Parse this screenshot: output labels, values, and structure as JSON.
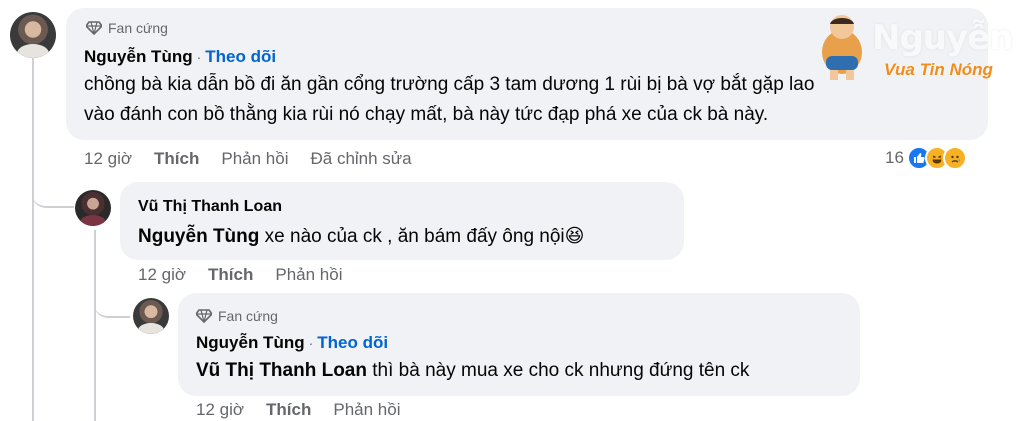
{
  "comment1": {
    "badge": "Fan cứng",
    "author": "Nguyễn Tùng",
    "follow": "Theo dõi",
    "line1": "chồng bà kia dẫn bồ đi ăn gần cổng trường cấp 3 tam dương 1 rùi bị bà vợ bắt gặp lao",
    "line2": "vào đánh con bồ thằng kia rùi nó chạy mất, bà này tức đạp phá xe của ck bà này.",
    "time": "12 giờ",
    "like": "Thích",
    "reply": "Phản hồi",
    "edited": "Đã chỉnh sửa",
    "reaction_count": "16",
    "reactions": [
      "like-icon",
      "laugh-icon",
      "sad-icon"
    ]
  },
  "comment2": {
    "author": "Vũ Thị Thanh Loan",
    "mention": "Nguyễn Tùng",
    "text": " xe nào của ck , ăn bám đấy ông nội",
    "emoji": "😆",
    "time": "12 giờ",
    "like": "Thích",
    "reply": "Phản hồi"
  },
  "comment3": {
    "badge": "Fan cứng",
    "author": "Nguyễn Tùng",
    "follow": "Theo dõi",
    "mention": "Vũ Thị Thanh Loan",
    "text": " thì bà này mua xe cho ck nhưng đứng tên ck",
    "time": "12 giờ",
    "like": "Thích",
    "reply": "Phản hồi"
  },
  "watermark": {
    "name": "Nguyễn Sĩ",
    "tagline": "Vua Tin Nóng"
  },
  "colors": {
    "bubble": "#f0f2f5",
    "link_blue": "#0064d1",
    "muted": "#65676b",
    "like_blue": "#1877f2"
  }
}
